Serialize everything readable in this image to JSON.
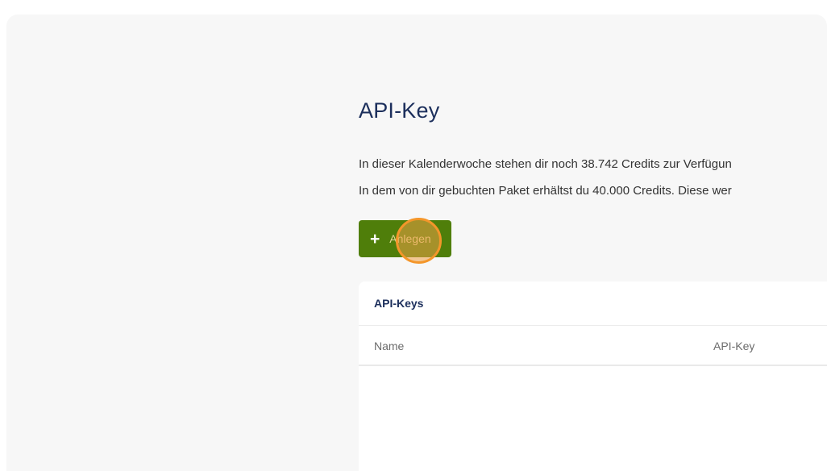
{
  "page": {
    "title": "API-Key",
    "info_line_1": "In dieser Kalenderwoche stehen dir noch 38.742 Credits zur Verfügun",
    "info_line_2": "In dem von dir gebuchten Paket erhältst du 40.000 Credits. Diese wer"
  },
  "create_button": {
    "icon": "plus-icon",
    "label": "Anlegen"
  },
  "api_keys_table": {
    "title": "API-Keys",
    "columns": [
      "Name",
      "API-Key"
    ],
    "rows": []
  },
  "colors": {
    "background": "#f7f7f7",
    "title": "#1c2f5c",
    "button": "#4f7e0a",
    "click_indicator": "#f4962a"
  }
}
